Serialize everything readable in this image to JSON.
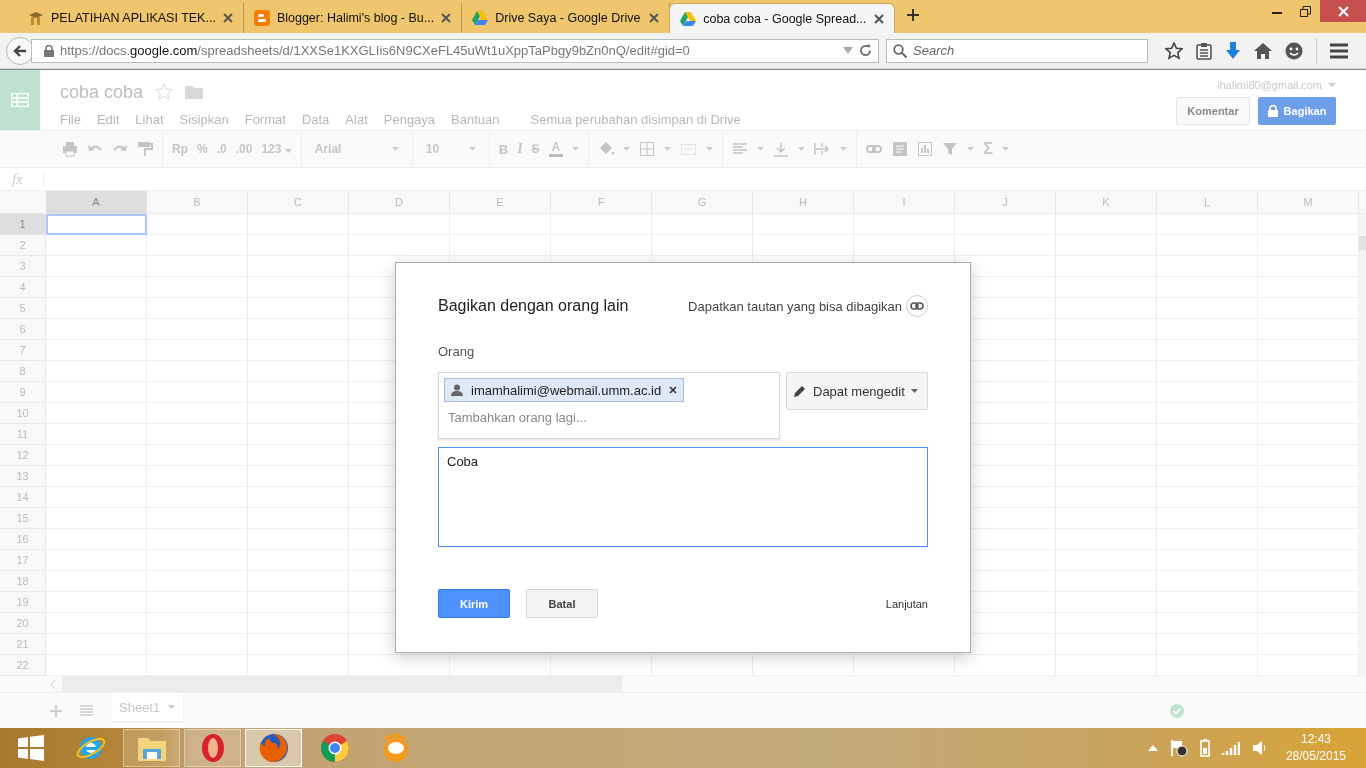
{
  "browser_tabs": [
    {
      "title": "PELATIHAN APLIKASI TEK...",
      "kind": "course",
      "selected": false
    },
    {
      "title": "Blogger: Halimi's blog - Bu...",
      "kind": "blogger",
      "selected": false
    },
    {
      "title": "Drive Saya - Google Drive",
      "kind": "drive",
      "selected": false
    },
    {
      "title": "coba coba - Google Spread...",
      "kind": "drive",
      "selected": true
    }
  ],
  "address_bar": {
    "url": "https://docs.**google.com**/spreadsheets/d/1XXSe1KXGLIis6N9CXeFL45uWt1uXppTaPbgy9bZn0nQ/edit#gid=0"
  },
  "search": {
    "placeholder": "Search"
  },
  "document": {
    "title": "coba coba",
    "account": "ihalimi80@gmail.com",
    "menu": [
      "File",
      "Edit",
      "Lihat",
      "Sisipkan",
      "Format",
      "Data",
      "Alat",
      "Pengaya",
      "Bantuan"
    ],
    "save_status": "Semua perubahan disimpan di Drive",
    "comment_button": "Komentar",
    "share_button": "Bagikan"
  },
  "toolbar": {
    "currency": "Rp",
    "percent": "%",
    "decrease_decimals": ".0",
    "increase_decimals": ".00",
    "number_format": "123",
    "font": "Arial",
    "font_size": "10",
    "bold": "B",
    "italic": "I",
    "strikethrough": "S",
    "text_color": "A",
    "functions": "Σ"
  },
  "formula_bar": {
    "label": "fx"
  },
  "grid": {
    "columns": [
      {
        "label": "A",
        "selected": true
      },
      {
        "label": "B",
        "selected": false
      },
      {
        "label": "C",
        "selected": false
      },
      {
        "label": "D",
        "selected": false
      },
      {
        "label": "E",
        "selected": false
      },
      {
        "label": "F",
        "selected": false
      },
      {
        "label": "G",
        "selected": false
      },
      {
        "label": "H",
        "selected": false
      },
      {
        "label": "I",
        "selected": false
      },
      {
        "label": "J",
        "selected": false
      },
      {
        "label": "K",
        "selected": false
      },
      {
        "label": "L",
        "selected": false
      },
      {
        "label": "M",
        "selected": false
      }
    ],
    "rows": [
      {
        "label": "1",
        "selected": true
      },
      {
        "label": "2",
        "selected": false
      },
      {
        "label": "3",
        "selected": false
      },
      {
        "label": "4",
        "selected": false
      },
      {
        "label": "5",
        "selected": false
      },
      {
        "label": "6",
        "selected": false
      },
      {
        "label": "7",
        "selected": false
      },
      {
        "label": "8",
        "selected": false
      },
      {
        "label": "9",
        "selected": false
      },
      {
        "label": "10",
        "selected": false
      },
      {
        "label": "11",
        "selected": false
      },
      {
        "label": "12",
        "selected": false
      },
      {
        "label": "13",
        "selected": false
      },
      {
        "label": "14",
        "selected": false
      },
      {
        "label": "15",
        "selected": false
      },
      {
        "label": "16",
        "selected": false
      },
      {
        "label": "17",
        "selected": false
      },
      {
        "label": "18",
        "selected": false
      },
      {
        "label": "19",
        "selected": false
      },
      {
        "label": "20",
        "selected": false
      },
      {
        "label": "21",
        "selected": false
      },
      {
        "label": "22",
        "selected": false
      }
    ]
  },
  "sheet_tabs": [
    {
      "label": "Sheet1",
      "selected": true
    }
  ],
  "dialog": {
    "title": "Bagikan dengan orang lain",
    "link_text": "Dapatkan tautan yang bisa dibagikan",
    "people_label": "Orang",
    "recipients": [
      {
        "email": "imamhalimi@webmail.umm.ac.id"
      }
    ],
    "placeholder": "Tambahkan orang lagi...",
    "permission": "Dapat mengedit",
    "message": "Coba",
    "send_button": "Kirim",
    "cancel_button": "Batal",
    "advanced_link": "Lanjutan"
  },
  "taskbar": {
    "apps": [
      {
        "kind": "ie",
        "running": false,
        "selected": false
      },
      {
        "kind": "explorer",
        "running": true,
        "selected": false
      },
      {
        "kind": "opera",
        "running": true,
        "selected": false
      },
      {
        "kind": "firefox",
        "running": true,
        "selected": true
      },
      {
        "kind": "chrome",
        "running": false,
        "selected": false
      },
      {
        "kind": "gom",
        "running": false,
        "selected": false
      }
    ],
    "time": "12:43",
    "date": "28/05/2015"
  }
}
